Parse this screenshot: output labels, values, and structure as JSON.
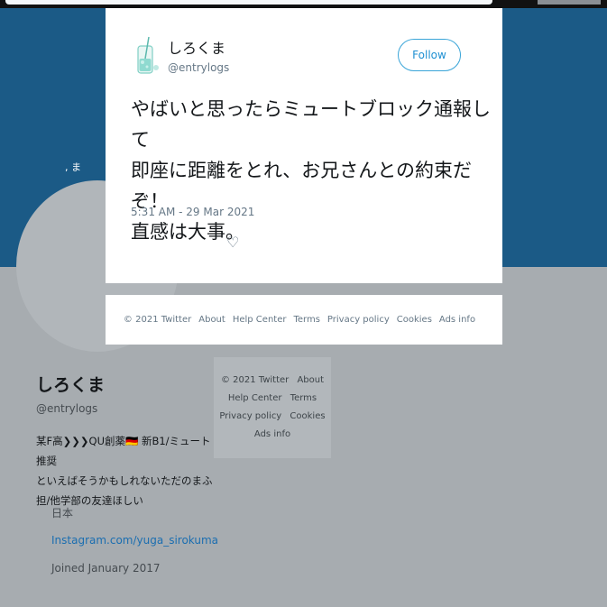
{
  "colors": {
    "banner": "#1b5a86",
    "accent": "#1d8fd2",
    "link": "#1b6eb0"
  },
  "banner": {
    "tag": ", ま"
  },
  "tweet": {
    "author_name": "しろくま",
    "author_handle": "@entrylogs",
    "follow_label": "Follow",
    "more_icon": "",
    "text_lines": [
      "やばいと思ったらミュートブロック通報して",
      "即座に距離をとれ、お兄さんとの約束だぞ！",
      "直感は大事。"
    ],
    "timestamp": "5:31 AM - 29 Mar 2021",
    "actions": {
      "reply_icon": "",
      "retweet_icon": "",
      "like_icon": "♡"
    }
  },
  "modal_footer": {
    "items": [
      "© 2021 Twitter",
      "About",
      "Help Center",
      "Terms",
      "Privacy policy",
      "Cookies",
      "Ads info"
    ]
  },
  "profile": {
    "name": "しろくま",
    "handle": "@entrylogs",
    "bio_lines": [
      "某F高❯❯❯QU創薬🇩🇪 新B1/ミュート推奨",
      "といえばそうかもしれないただのまふ",
      "担/他学部の友達ほしい"
    ],
    "location_icon": "",
    "location": "日本",
    "link_icon": "",
    "link": "Instagram.com/yuga_sirokuma",
    "joined_icon": "",
    "joined": "Joined January 2017"
  },
  "side_footer": {
    "rows": [
      [
        "© 2021 Twitter",
        "About"
      ],
      [
        "Help Center",
        "Terms"
      ],
      [
        "Privacy policy",
        "Cookies"
      ],
      [
        "Ads info"
      ]
    ]
  }
}
